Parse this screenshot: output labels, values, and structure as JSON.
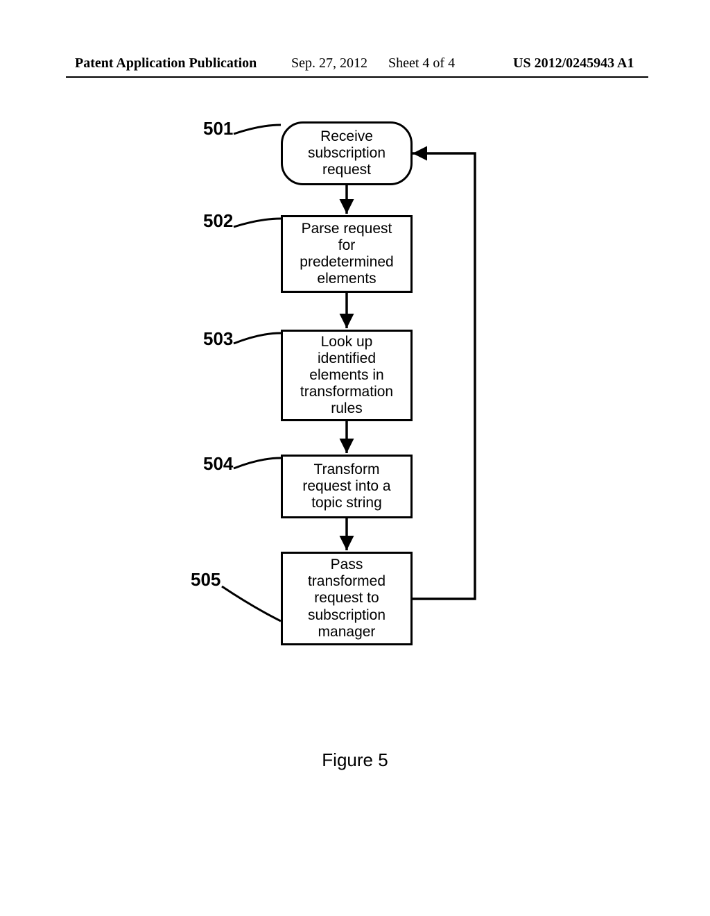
{
  "header": {
    "publication": "Patent Application Publication",
    "date": "Sep. 27, 2012",
    "sheet": "Sheet 4 of 4",
    "docnum": "US 2012/0245943 A1"
  },
  "labels": {
    "n501": "501",
    "n502": "502",
    "n503": "503",
    "n504": "504",
    "n505": "505"
  },
  "nodes": {
    "n501": {
      "line1": "Receive",
      "line2": "subscription",
      "line3": "request"
    },
    "n502": {
      "line1": "Parse request",
      "line2": "for",
      "line3": "predetermined",
      "line4": "elements"
    },
    "n503": {
      "line1": "Look up",
      "line2": "identified",
      "line3": "elements in",
      "line4": "transformation",
      "line5": "rules"
    },
    "n504": {
      "line1": "Transform",
      "line2": "request into a",
      "line3": "topic string"
    },
    "n505": {
      "line1": "Pass",
      "line2": "transformed",
      "line3": "request to",
      "line4": "subscription",
      "line5": "manager"
    }
  },
  "caption": "Figure 5"
}
